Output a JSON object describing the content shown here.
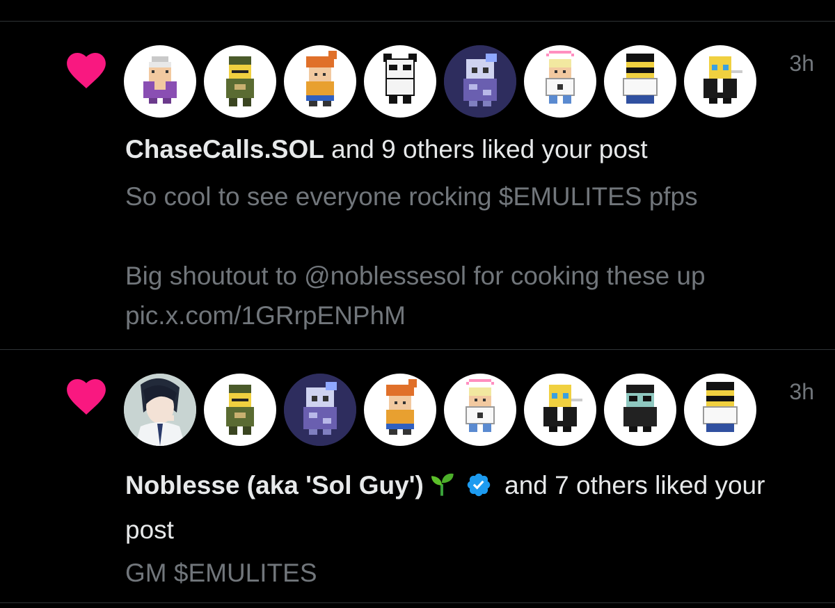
{
  "colors": {
    "background": "#000000",
    "heart": "#f91880",
    "text_primary": "#e7e9ea",
    "text_secondary": "#71767b",
    "divider": "#2f3336",
    "verified": "#1d9bf0"
  },
  "notifications": [
    {
      "icon": "heart-icon",
      "time": "3h",
      "avatars": [
        "pixel-queen-avatar",
        "pixel-soldier-avatar",
        "pixel-orange-hair-avatar",
        "pixel-panda-avatar",
        "pixel-glitch-avatar",
        "pixel-angel-avatar",
        "pixel-sunglasses-avatar",
        "pixel-suit-avatar"
      ],
      "headline": {
        "name": "ChaseCalls.SOL",
        "rest": " and 9 others liked your post"
      },
      "preview": [
        "So cool to see everyone rocking $EMULITES pfps",
        "",
        "Big shoutout to @noblessesol for cooking these up pic.x.com/1GRrpENPhM"
      ]
    },
    {
      "icon": "heart-icon",
      "time": "3h",
      "avatars": [
        "anime-guy-avatar",
        "pixel-soldier-avatar",
        "pixel-glitch-avatar",
        "pixel-orange-hair-avatar",
        "pixel-angel-avatar",
        "pixel-suit-avatar",
        "pixel-ninja-avatar",
        "pixel-sunglasses-avatar"
      ],
      "headline": {
        "name": "Noblesse (aka 'Sol Guy')",
        "rest": " and 7 others liked your post"
      },
      "preview": [
        "GM $EMULITES"
      ]
    }
  ]
}
